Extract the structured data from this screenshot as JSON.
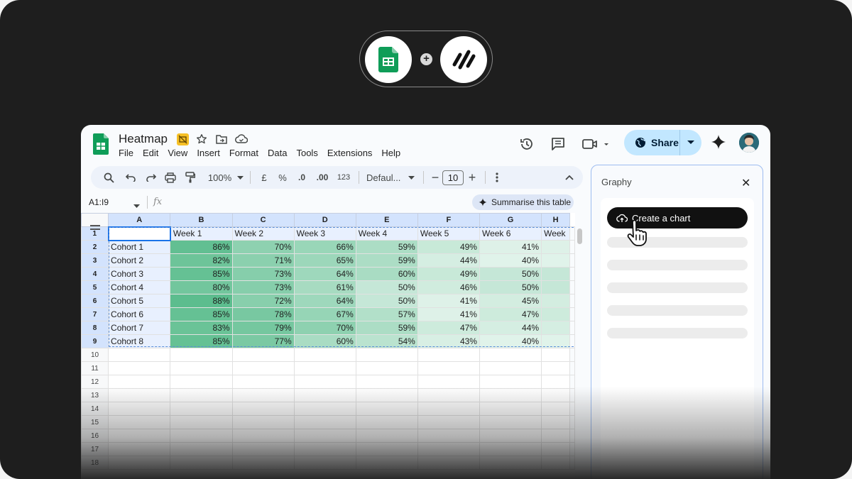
{
  "document": {
    "title": "Heatmap",
    "menu": [
      "File",
      "Edit",
      "View",
      "Insert",
      "Format",
      "Data",
      "Tools",
      "Extensions",
      "Help"
    ]
  },
  "header": {
    "share_label": "Share"
  },
  "toolbar": {
    "zoom": "100%",
    "currency": "£",
    "percent": "%",
    "decrease_decimal": ".0",
    "increase_decimal": ".00",
    "number_format": "123",
    "font": "Defaul...",
    "font_size": "10"
  },
  "formula_bar": {
    "name_box": "A1:I9",
    "fx": "fx",
    "summarise_label": "Summarise this table"
  },
  "grid": {
    "columns": [
      "A",
      "B",
      "C",
      "D",
      "E",
      "F",
      "G",
      "H"
    ],
    "header_row": [
      "",
      "Week 1",
      "Week 2",
      "Week 3",
      "Week 4",
      "Week 5",
      "Week 6",
      "Week"
    ],
    "rows": [
      {
        "label": "Cohort 1",
        "values": [
          "86%",
          "70%",
          "66%",
          "59%",
          "49%",
          "41%"
        ]
      },
      {
        "label": "Cohort 2",
        "values": [
          "82%",
          "71%",
          "65%",
          "59%",
          "44%",
          "40%"
        ]
      },
      {
        "label": "Cohort 3",
        "values": [
          "85%",
          "73%",
          "64%",
          "60%",
          "49%",
          "50%"
        ]
      },
      {
        "label": "Cohort 4",
        "values": [
          "80%",
          "73%",
          "61%",
          "50%",
          "46%",
          "50%"
        ]
      },
      {
        "label": "Cohort 5",
        "values": [
          "88%",
          "72%",
          "64%",
          "50%",
          "41%",
          "45%"
        ]
      },
      {
        "label": "Cohort 6",
        "values": [
          "85%",
          "78%",
          "67%",
          "57%",
          "41%",
          "47%"
        ]
      },
      {
        "label": "Cohort 7",
        "values": [
          "83%",
          "79%",
          "70%",
          "59%",
          "47%",
          "44%"
        ]
      },
      {
        "label": "Cohort 8",
        "values": [
          "85%",
          "77%",
          "60%",
          "54%",
          "43%",
          "40%"
        ]
      }
    ],
    "row_numbers": [
      "1",
      "2",
      "3",
      "4",
      "5",
      "6",
      "7",
      "8",
      "9",
      "10",
      "11",
      "12",
      "13",
      "14",
      "15",
      "16",
      "17",
      "18"
    ],
    "heatmap_colors": {
      "high": "#57bb8a",
      "low": "#ffffff"
    }
  },
  "panel": {
    "title": "Graphy",
    "create_chart_label": "Create a chart"
  },
  "colors": {
    "accent": "#1a73e8",
    "share_bg": "#c2e7ff",
    "sheets_green": "#0f9d58"
  }
}
